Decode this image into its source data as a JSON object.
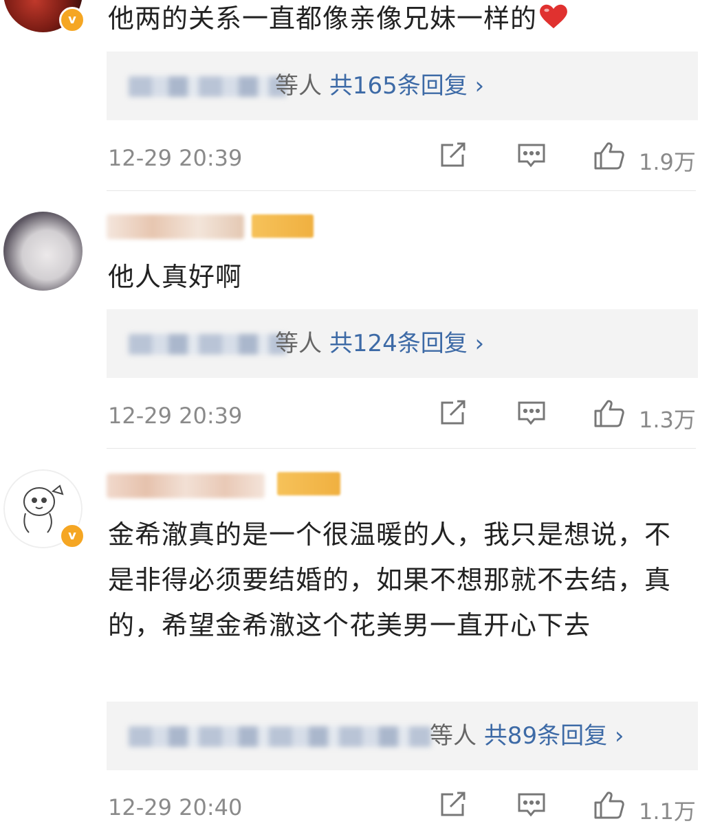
{
  "comments": [
    {
      "text": "他两的关系一直都像亲像兄妹一样的",
      "reply_suffix": "等人",
      "reply_link": "共165条回复",
      "reply_arrow": "›",
      "time": "12-29 20:39",
      "likes": "1.9万",
      "emoji": "heart"
    },
    {
      "text": "他人真好啊",
      "reply_suffix": "等人",
      "reply_link": "共124条回复",
      "reply_arrow": "›",
      "time": "12-29 20:39",
      "likes": "1.3万"
    },
    {
      "text": "金希澈真的是一个很温暖的人，我只是想说，不是非得必须要结婚的，如果不想那就不去结，真的，希望金希澈这个花美男一直开心下去",
      "reply_suffix": "等人",
      "reply_link": "共89条回复",
      "reply_arrow": "›",
      "time": "12-29 20:40",
      "likes": "1.1万"
    }
  ],
  "badge_letter": "v",
  "colors": {
    "link": "#3d6aa6",
    "meta": "#8a8a8a",
    "reply_bg": "#f3f3f3",
    "verified_badge": "#f5a623",
    "heart": "#e0312f"
  }
}
